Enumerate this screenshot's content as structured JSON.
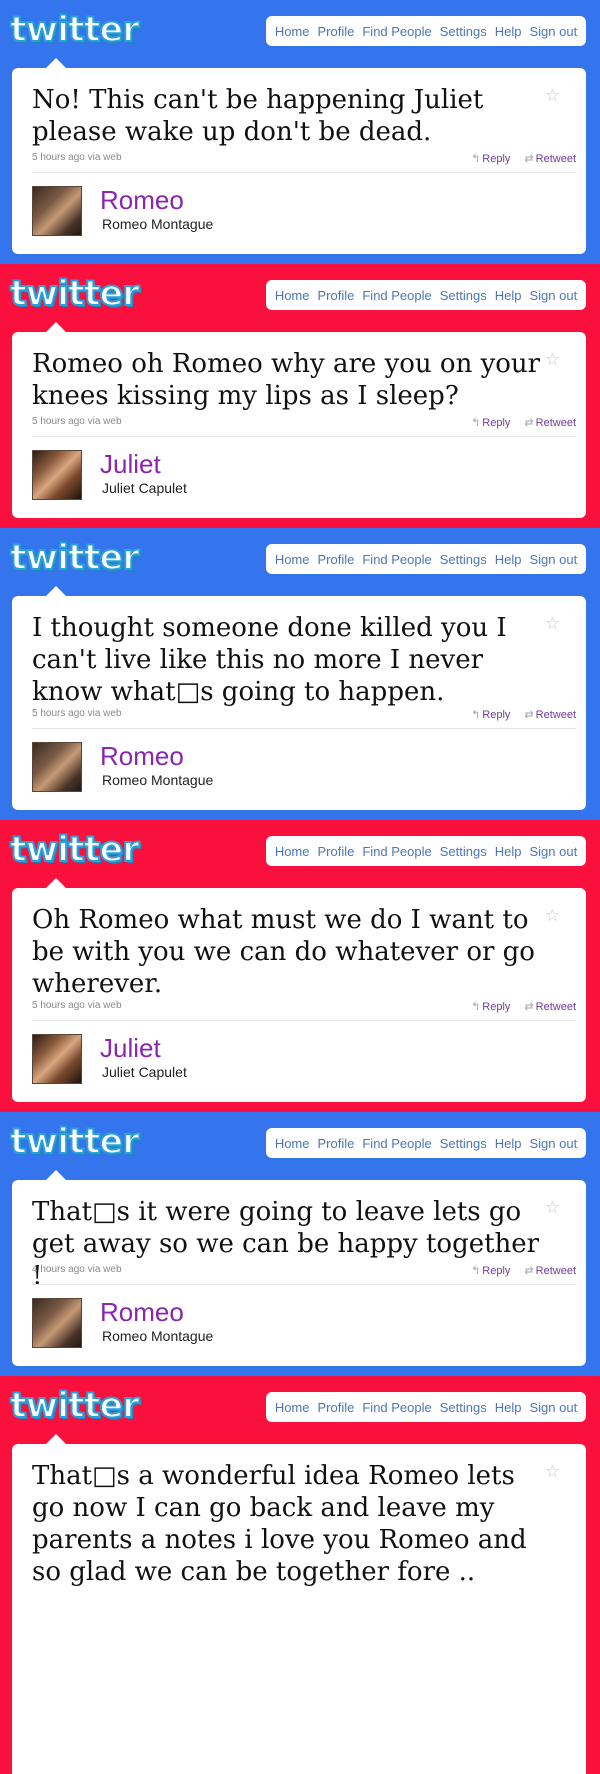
{
  "logo": "twitter",
  "nav": [
    "Home",
    "Profile",
    "Find People",
    "Settings",
    "Help",
    "Sign out"
  ],
  "actions": {
    "reply": "Reply",
    "retweet": "Retweet"
  },
  "tweets": [
    {
      "theme": "blue",
      "text": "No! This can't be happening Juliet please wake up don't be dead.",
      "time": "5 hours ago via web",
      "name": "Romeo",
      "fullname": "Romeo Montague",
      "avatar": "romeo-avatar"
    },
    {
      "theme": "red",
      "text": "Romeo oh Romeo why are you on your knees kissing my lips as I sleep?",
      "time": "5 hours ago via web",
      "name": "Juliet",
      "fullname": "Juliet Capulet",
      "avatar": "juliet-avatar"
    },
    {
      "theme": "blue",
      "text": "I thought someone done killed you I can't live like this no more I never know what□s  going  to  happen.",
      "time": "5 hours ago via web",
      "name": "Romeo",
      "fullname": "Romeo Montague",
      "avatar": "romeo-avatar"
    },
    {
      "theme": "red",
      "text": "Oh Romeo what must we do I want to be with you we can do whatever  or go wherever.",
      "time": "5 hours ago via web",
      "name": "Juliet",
      "fullname": "Juliet Capulet",
      "avatar": "juliet-avatar"
    },
    {
      "theme": "blue",
      "text": "That□s it were going to leave lets go get away so we can be happy together !",
      "time": "4 hours ago via web",
      "name": "Romeo",
      "fullname": "Romeo Montague",
      "avatar": "romeo-avatar"
    },
    {
      "theme": "red",
      "text": "That□s a wonderful idea Romeo  lets go now I can go back and leave my parents a notes i love you Romeo and so glad we can be  together  fore ..",
      "time": "",
      "name": "",
      "fullname": "",
      "avatar": ""
    }
  ],
  "colors": {
    "blue_bg": "#3474ec",
    "red_bg": "#f9103c",
    "name": "#8a26b2",
    "action": "#6f3d9b",
    "nav_link": "#4b77b8"
  },
  "icons": {
    "favorite": "star-icon",
    "reply": "reply-arrow-icon",
    "retweet": "retweet-icon"
  }
}
